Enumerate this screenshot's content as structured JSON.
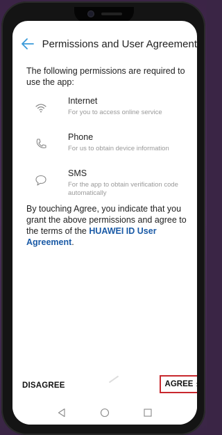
{
  "header": {
    "title": "Permissions and User Agreement"
  },
  "intro": "The following permissions are required to use the app:",
  "permissions": [
    {
      "name": "Internet",
      "desc": "For you to access online service",
      "icon": "wifi-icon"
    },
    {
      "name": "Phone",
      "desc": "For us to obtain device information",
      "icon": "phone-icon"
    },
    {
      "name": "SMS",
      "desc": "For the app to obtain verification code automatically",
      "icon": "sms-icon"
    }
  ],
  "agreement": {
    "text": "By touching Agree, you indicate that you grant the above permissions and agree to the terms of the ",
    "link": "HUAWEI ID User Agreement",
    "end": "."
  },
  "actions": {
    "disagree": "DISAGREE",
    "agree": "AGREE",
    "agree_chevron": "›"
  },
  "colors": {
    "accent": "#3a9ad9",
    "link": "#1a5aa6",
    "highlight": "#c8282e"
  }
}
